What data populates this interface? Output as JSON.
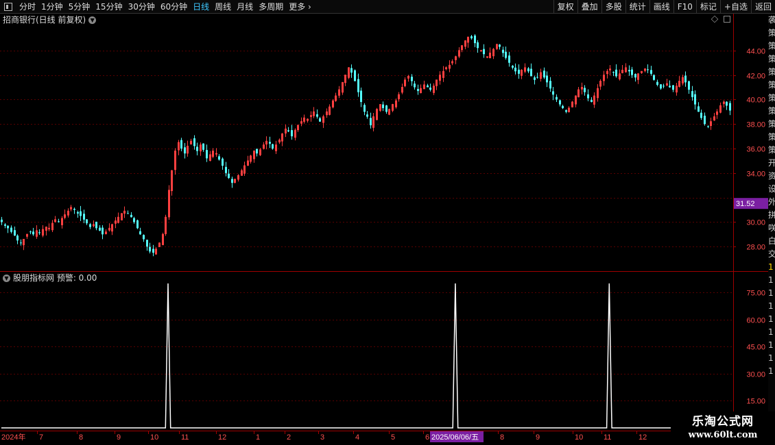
{
  "toolbar": {
    "periods": [
      "分时",
      "1分钟",
      "5分钟",
      "15分钟",
      "30分钟",
      "60分钟",
      "日线",
      "周线",
      "月线",
      "多周期",
      "更多"
    ],
    "active_period": "日线",
    "right_buttons": [
      "复权",
      "叠加",
      "多股",
      "统计",
      "画线",
      "F10",
      "标记",
      "+自选",
      "返回"
    ]
  },
  "main_chart": {
    "title": "招商银行(日线 前复权)",
    "price_ticks": [
      "44.00",
      "42.00",
      "40.00",
      "38.00",
      "36.00",
      "34.00",
      "30.00",
      "28.00"
    ],
    "current_price_badge": "31.52",
    "colors": {
      "up": "#ff4040",
      "down": "#54fcfc",
      "badge_bg": "#7b1fa2",
      "grid": "#5a0000",
      "axis_line": "#a00000"
    }
  },
  "indicator": {
    "title": "股朋指标网 预警: 0.00",
    "ticks": [
      "75.00",
      "60.00",
      "45.00",
      "30.00",
      "15.00"
    ],
    "signal_color": "#ffffff"
  },
  "x_axis": {
    "labels": [
      "2024年",
      "7",
      "8",
      "9",
      "10",
      "11",
      "12",
      "1",
      "2",
      "3",
      "4",
      "5",
      "6",
      "2025/06/06/五",
      "8",
      "9",
      "10",
      "11",
      "12"
    ],
    "cursor_label": "2025/06/06/五"
  },
  "right_strip": [
    "袭",
    "策",
    "策",
    "策",
    "策",
    "策",
    "策",
    "策",
    "策",
    "策",
    "策",
    "开",
    "资",
    "设",
    "外",
    "拼",
    "咲",
    "白",
    "交",
    "1",
    "1",
    "1",
    "1",
    "1",
    "1",
    "1",
    "1",
    "1"
  ],
  "watermark": {
    "line1": "乐淘公式网",
    "line2": "www.60lt.com"
  },
  "chart_data": {
    "type": "candlestick",
    "price_axis": {
      "ylim": [
        26,
        46
      ],
      "ticks": [
        28,
        30,
        34,
        36,
        38,
        40,
        42,
        44
      ],
      "current_price": 31.52
    },
    "candles_close": [
      30.0,
      29.7,
      29.5,
      29.2,
      28.9,
      28.5,
      28.3,
      28.6,
      29.0,
      29.2,
      29.0,
      29.3,
      29.1,
      29.4,
      29.6,
      29.5,
      29.9,
      30.2,
      30.0,
      30.3,
      30.6,
      30.9,
      31.2,
      31.0,
      30.7,
      30.5,
      30.2,
      29.9,
      29.6,
      29.8,
      29.5,
      29.3,
      29.0,
      29.2,
      29.5,
      29.8,
      30.1,
      30.4,
      30.7,
      30.9,
      30.7,
      30.4,
      30.0,
      29.5,
      29.0,
      28.6,
      28.0,
      27.6,
      27.5,
      27.8,
      28.3,
      29.0,
      30.4,
      32.6,
      34.2,
      35.8,
      36.5,
      36.0,
      35.6,
      36.2,
      36.6,
      36.2,
      35.8,
      36.3,
      35.9,
      35.2,
      35.5,
      35.8,
      35.6,
      35.1,
      34.6,
      34.0,
      33.6,
      33.2,
      33.5,
      33.8,
      34.2,
      34.6,
      35.0,
      35.4,
      35.8,
      35.6,
      35.9,
      36.3,
      36.6,
      36.4,
      36.0,
      36.3,
      36.7,
      37.2,
      37.6,
      37.4,
      37.0,
      37.5,
      37.9,
      38.2,
      38.5,
      38.4,
      38.7,
      39.0,
      38.6,
      38.2,
      38.6,
      39.0,
      39.4,
      39.9,
      40.3,
      40.8,
      41.4,
      42.0,
      42.6,
      42.2,
      41.5,
      40.6,
      39.8,
      39.0,
      38.6,
      37.9,
      38.6,
      39.2,
      39.6,
      39.3,
      39.0,
      39.2,
      39.6,
      39.9,
      40.4,
      41.0,
      41.6,
      41.9,
      41.5,
      41.0,
      40.7,
      40.9,
      41.2,
      41.0,
      40.8,
      41.1,
      41.6,
      42.0,
      42.3,
      42.6,
      42.8,
      43.1,
      43.5,
      44.0,
      44.4,
      44.8,
      45.1,
      45.0,
      44.6,
      44.2,
      44.0,
      43.7,
      43.5,
      43.8,
      44.1,
      44.5,
      44.3,
      43.8,
      43.4,
      43.0,
      42.6,
      42.3,
      42.1,
      42.4,
      42.6,
      42.3,
      41.9,
      41.6,
      41.8,
      42.2,
      41.8,
      41.4,
      40.9,
      40.4,
      40.0,
      39.6,
      39.3,
      39.0,
      39.3,
      39.8,
      40.3,
      40.8,
      41.0,
      40.6,
      40.1,
      39.8,
      40.3,
      40.9,
      41.5,
      42.0,
      42.3,
      42.5,
      42.2,
      41.9,
      42.1,
      42.4,
      42.6,
      42.3,
      42.0,
      41.8,
      42.1,
      42.3,
      42.5,
      42.4,
      42.1,
      41.6,
      41.2,
      40.9,
      41.1,
      41.3,
      41.0,
      40.8,
      41.1,
      41.5,
      41.8,
      41.4,
      40.8,
      40.2,
      39.6,
      39.0,
      38.5,
      38.0,
      37.8,
      38.2,
      38.6,
      39.0,
      39.5,
      39.8,
      39.5,
      39.1
    ],
    "up_color": "#ff4040",
    "down_color": "#54fcfc",
    "indicator_axis": {
      "ylim": [
        0,
        80
      ],
      "ticks": [
        15,
        30,
        45,
        60,
        75
      ]
    },
    "indicator_values": [
      0,
      0,
      0,
      0,
      0,
      0,
      0,
      0,
      0,
      0,
      0,
      0,
      0,
      0,
      0,
      0,
      0,
      0,
      0,
      0,
      0,
      0,
      0,
      0,
      0,
      0,
      0,
      0,
      0,
      0,
      0,
      0,
      0,
      0,
      0,
      0,
      0,
      0,
      0,
      0,
      0,
      0,
      0,
      0,
      0,
      0,
      0,
      0,
      0,
      0,
      0,
      0,
      0,
      0,
      0,
      0,
      0,
      0,
      0,
      0,
      0,
      0,
      0,
      0,
      0,
      80,
      0,
      0,
      0,
      0,
      0,
      0,
      0,
      0,
      0,
      0,
      0,
      0,
      0,
      0,
      0,
      0,
      0,
      0,
      0,
      0,
      0,
      0,
      0,
      0,
      0,
      0,
      0,
      0,
      0,
      0,
      0,
      0,
      0,
      0,
      0,
      0,
      0,
      0,
      0,
      0,
      0,
      0,
      0,
      0,
      0,
      0,
      0,
      0,
      0,
      0,
      0,
      0,
      0,
      0,
      0,
      0,
      0,
      0,
      0,
      0,
      0,
      0,
      0,
      0,
      0,
      0,
      0,
      0,
      0,
      0,
      0,
      0,
      0,
      0,
      0,
      0,
      0,
      0,
      0,
      0,
      0,
      0,
      0,
      0,
      0,
      0,
      0,
      0,
      0,
      0,
      0,
      0,
      0,
      0,
      0,
      0,
      0,
      0,
      0,
      0,
      0,
      0,
      0,
      0,
      0,
      0,
      0,
      0,
      0,
      0,
      0,
      80,
      0,
      0,
      0,
      0,
      0,
      0,
      0,
      0,
      0,
      0,
      0,
      0,
      0,
      0,
      0,
      0,
      0,
      0,
      0,
      0,
      0,
      0,
      0,
      0,
      0,
      0,
      0,
      0,
      0,
      0,
      0,
      0,
      0,
      0,
      0,
      0,
      0,
      0,
      0,
      0,
      0,
      0,
      0,
      0,
      0,
      0,
      0,
      0,
      0,
      0,
      0,
      0,
      0,
      0,
      0,
      0,
      0,
      0,
      0,
      80,
      0,
      0,
      0,
      0,
      0,
      0,
      0,
      0,
      0,
      0,
      0,
      0,
      0,
      0,
      0,
      0,
      0,
      0,
      0,
      0,
      0,
      0,
      0,
      0,
      0,
      0,
      0,
      0,
      0,
      0,
      0,
      0,
      0,
      0,
      0,
      0,
      0,
      0,
      0,
      0,
      0,
      0,
      0,
      0,
      0,
      0,
      0
    ]
  }
}
